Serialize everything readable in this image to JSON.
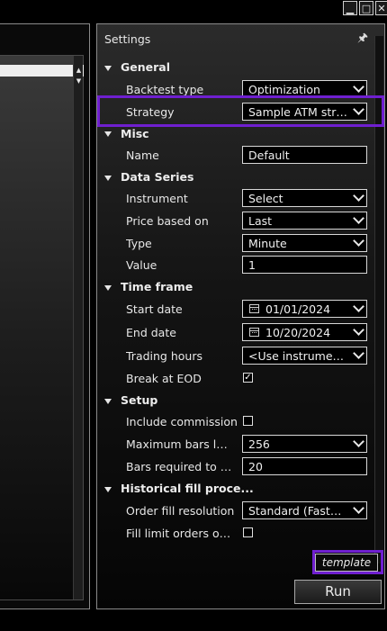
{
  "window_controls": {
    "minimize": "▁",
    "maximize": "□",
    "close": "✕"
  },
  "settings": {
    "title": "Settings",
    "template_label": "template",
    "run_label": "Run"
  },
  "categories": {
    "general": "General",
    "misc": "Misc",
    "data_series": "Data Series",
    "time_frame": "Time frame",
    "setup": "Setup",
    "historical_fill": "Historical fill proce..."
  },
  "properties": {
    "backtest_type": {
      "label": "Backtest type",
      "value": "Optimization"
    },
    "strategy": {
      "label": "Strategy",
      "value": "Sample ATM strategy"
    },
    "name": {
      "label": "Name",
      "value": "Default"
    },
    "instrument": {
      "label": "Instrument",
      "value": "Select"
    },
    "price_based_on": {
      "label": "Price based on",
      "value": "Last"
    },
    "type": {
      "label": "Type",
      "value": "Minute"
    },
    "value": {
      "label": "Value",
      "value": "1"
    },
    "start_date": {
      "label": "Start date",
      "value": "01/01/2024"
    },
    "end_date": {
      "label": "End date",
      "value": "10/20/2024"
    },
    "trading_hours": {
      "label": "Trading hours",
      "value": "<Use instrument..."
    },
    "break_at_eod": {
      "label": "Break at EOD",
      "checked": true
    },
    "include_commission": {
      "label": "Include commission",
      "checked": false
    },
    "maximum_bars": {
      "label": "Maximum bars loo...",
      "value": "256"
    },
    "bars_required": {
      "label": "Bars required to tra...",
      "value": "20"
    },
    "order_fill_resolution": {
      "label": "Order fill resolution",
      "value": "Standard (Fastest)"
    },
    "fill_limit_orders": {
      "label": "Fill limit orders on t...",
      "checked": false
    }
  },
  "colors": {
    "highlight": "#6f1fd0",
    "background": "#000000",
    "border": "#8a8a8a"
  }
}
